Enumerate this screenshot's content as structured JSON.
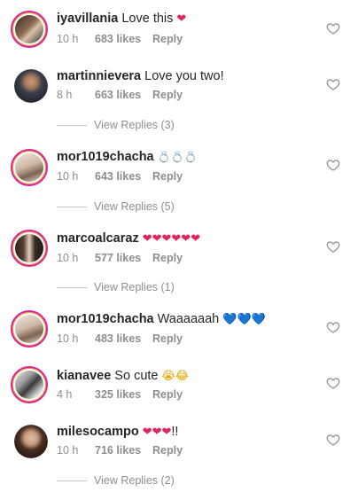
{
  "comments": [
    {
      "username": "iyavillania",
      "text": " Love this ",
      "emoji": "❤",
      "time": "10 h",
      "likes": "683 likes",
      "reply": "Reply"
    },
    {
      "username": "martinnievera",
      "text": " Love you two!",
      "time": "8 h",
      "likes": "663 likes",
      "reply": "Reply",
      "view_replies": "View Replies (3)"
    },
    {
      "username": "mor1019chacha",
      "text": " ",
      "emoji": "💍💍💍",
      "time": "10 h",
      "likes": "643 likes",
      "reply": "Reply",
      "view_replies": "View Replies (5)"
    },
    {
      "username": "marcoalcaraz",
      "text": " ",
      "emoji": "❤❤❤❤❤❤",
      "time": "10 h",
      "likes": "577 likes",
      "reply": "Reply",
      "view_replies": "View Replies (1)"
    },
    {
      "username": "mor1019chacha",
      "text": " Waaaaaah ",
      "emoji": "💙💙💙",
      "time": "10 h",
      "likes": "483 likes",
      "reply": "Reply"
    },
    {
      "username": "kianavee",
      "text": " So cute ",
      "emoji": "😭😂",
      "time": "4 h",
      "likes": "325 likes",
      "reply": "Reply"
    },
    {
      "username": "milesocampo",
      "text": " ",
      "emoji": "❤❤❤",
      "suffix": "!!",
      "time": "10 h",
      "likes": "716 likes",
      "reply": "Reply",
      "view_replies": "View Replies (2)"
    }
  ],
  "icons": {
    "like": "heart-outline-icon"
  },
  "colors": {
    "story_ring": "#d6249f",
    "muted": "#8e8e8e",
    "heart_red": "#e0245e",
    "heart_blue": "#2f9bdc"
  }
}
